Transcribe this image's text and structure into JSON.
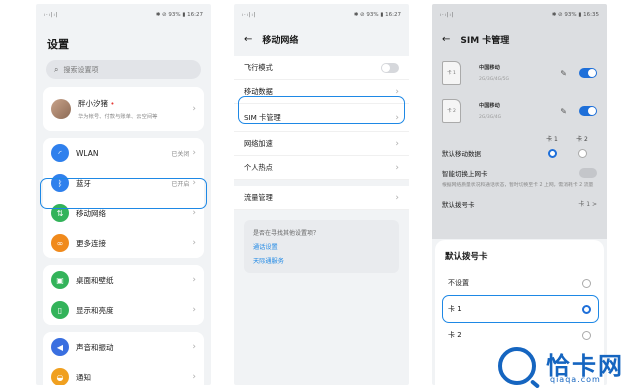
{
  "status": {
    "signal": "ᵢ·ᵢ|ᵢ|",
    "p1_right": "✱ ⊘ 93% ▮ 16:27",
    "p2_right": "✱ ⊘ 93% ▮ 16:27",
    "p3_right": "✱ ⊘ 93% ▮ 16:35"
  },
  "settings": {
    "title": "设置",
    "search_placeholder": "搜索设置项",
    "profile": {
      "name": "胖小汐猪",
      "subtitle": "华为帐号、付款与账单、云空间等"
    },
    "rows": [
      {
        "label": "WLAN",
        "value": "已关闭",
        "color": "#2f80ed",
        "icon": "wifi-icon",
        "glyph": "◜"
      },
      {
        "label": "蓝牙",
        "value": "已开启",
        "color": "#2f80ed",
        "icon": "bluetooth-icon",
        "glyph": "ᛒ"
      },
      {
        "label": "移动网络",
        "value": "",
        "color": "#33b35a",
        "icon": "mobile-network-icon",
        "glyph": "⇅"
      },
      {
        "label": "更多连接",
        "value": "",
        "color": "#f08a1c",
        "icon": "link-icon",
        "glyph": "∞"
      },
      {
        "label": "桌面和壁纸",
        "value": "",
        "color": "#33b35a",
        "icon": "wallpaper-icon",
        "glyph": "▣"
      },
      {
        "label": "显示和亮度",
        "value": "",
        "color": "#33b35a",
        "icon": "display-icon",
        "glyph": "▯"
      },
      {
        "label": "声音和振动",
        "value": "",
        "color": "#3a6fe0",
        "icon": "sound-icon",
        "glyph": "◀"
      },
      {
        "label": "通知",
        "value": "",
        "color": "#f0a020",
        "icon": "bell-icon",
        "glyph": "◒"
      }
    ]
  },
  "mobile_network": {
    "title": "移动网络",
    "rows": [
      "飞行模式",
      "移动数据",
      "SIM 卡管理",
      "网络加速",
      "个人热点"
    ],
    "traffic": "流量管理",
    "tip_question": "是否在寻找其他设置项？",
    "tip_links": [
      "通话设置",
      "天际通服务"
    ]
  },
  "sim_manage": {
    "title": "SIM 卡管理",
    "cards": [
      {
        "slot": "卡 1",
        "carrier": "中国移动",
        "network": "2G/3G/4G/5G"
      },
      {
        "slot": "卡 2",
        "carrier": "中国移动",
        "network": "2G/3G/4G"
      }
    ],
    "col_heads": [
      "卡 1",
      "卡 2"
    ],
    "default_data": "默认移动数据",
    "smart_switch": "智能切换上网卡",
    "smart_switch_sub": "根据网络质量状况和通话状态，暂时切换至卡 2 上网，需消耗卡 2 流量",
    "default_dial": "默认拨号卡",
    "default_dial_value": "卡 1 >",
    "sheet": {
      "title": "默认拨号卡",
      "options": [
        "不设置",
        "卡 1",
        "卡 2"
      ],
      "selected": "卡 1"
    }
  },
  "watermark": {
    "brand": "恰卡网",
    "domain": "qiaqa.com"
  },
  "colors": {
    "accent": "#1e6fd9",
    "highlight": "#1e88e5"
  }
}
